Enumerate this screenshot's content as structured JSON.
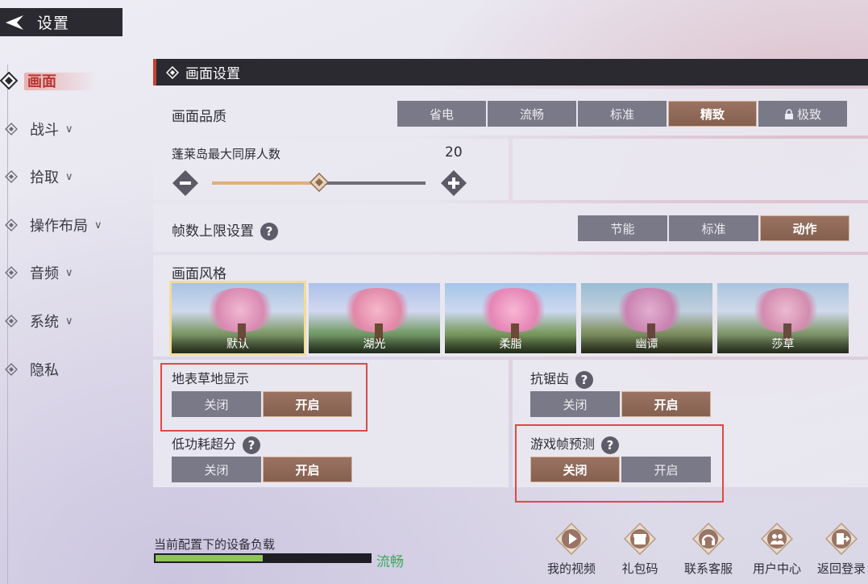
{
  "title": "设置",
  "nav": [
    {
      "label": "画面",
      "active": true
    },
    {
      "label": "战斗",
      "chevron": "∨"
    },
    {
      "label": "拾取",
      "chevron": "∨"
    },
    {
      "label": "操作布局",
      "chevron": "∨"
    },
    {
      "label": "音频",
      "chevron": "∨"
    },
    {
      "label": "系统",
      "chevron": "∨"
    },
    {
      "label": "隐私"
    }
  ],
  "section_title": "画面设置",
  "quality": {
    "label": "画面品质",
    "options": [
      "省电",
      "流畅",
      "标准",
      "精致",
      "极致"
    ],
    "selected": "精致",
    "locked": "极致"
  },
  "max_players": {
    "label": "蓬莱岛最大同屏人数",
    "value": "20",
    "slider_fraction": 0.5
  },
  "fps_limit": {
    "label": "帧数上限设置",
    "help": "?",
    "options": [
      "节能",
      "标准",
      "动作"
    ],
    "selected": "动作"
  },
  "style": {
    "label": "画面风格",
    "options": [
      "默认",
      "湖光",
      "柔脂",
      "幽谭",
      "莎草"
    ],
    "selected": "默认"
  },
  "grass": {
    "label": "地表草地显示",
    "off": "关闭",
    "on": "开启",
    "selected": "开启"
  },
  "antialias": {
    "label": "抗锯齿",
    "help": "?",
    "off": "关闭",
    "on": "开启",
    "selected": "开启"
  },
  "low_power": {
    "label": "低功耗超分",
    "help": "?",
    "off": "关闭",
    "on": "开启",
    "selected": "开启"
  },
  "frame_predict": {
    "label": "游戏帧预测",
    "help": "?",
    "off": "关闭",
    "on": "开启",
    "selected": "关闭"
  },
  "device_load": {
    "label": "当前配置下的设备负载",
    "status": "流畅",
    "fraction": 0.5,
    "status_color": "#3aa85a"
  },
  "footer": [
    "我的视频",
    "礼包码",
    "联系客服",
    "用户中心",
    "返回登录"
  ],
  "colors": {
    "accent": "#c8412f",
    "selected_option": "#8b6656",
    "highlight_box": "#e04848"
  }
}
